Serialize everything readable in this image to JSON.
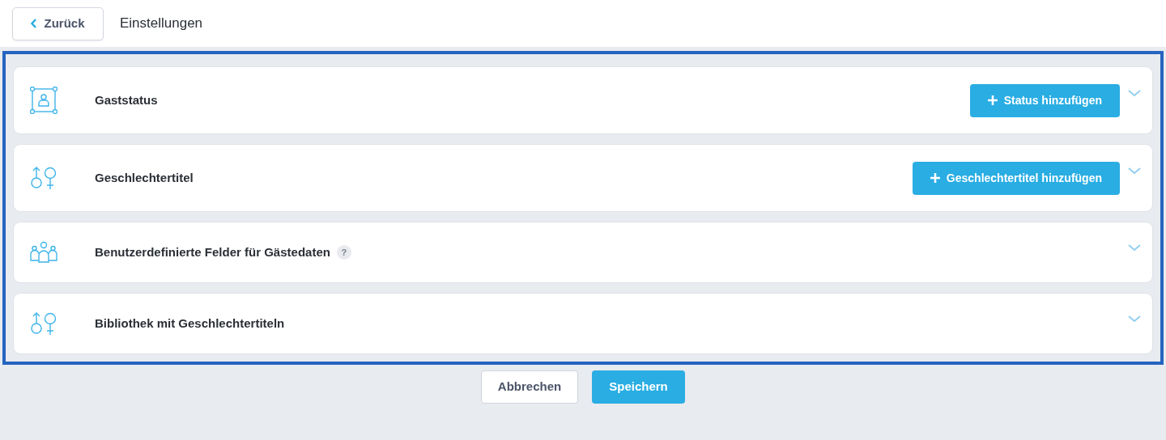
{
  "header": {
    "back_button": "Zurück",
    "title": "Einstellungen"
  },
  "panels": [
    {
      "kind": "guest",
      "title": "Gaststatus",
      "add_button": "Status hinzufügen",
      "expanded": false
    },
    {
      "kind": "gender",
      "title": "Geschlechtertitel",
      "add_button": "Geschlechtertitel hinzufügen",
      "expanded": false
    },
    {
      "kind": "group",
      "title": "Benutzerdefinierte Felder für Gästedaten",
      "help": "?",
      "expanded": false
    },
    {
      "kind": "gender",
      "title": "Bibliothek mit Geschlechtertiteln",
      "expanded": false
    }
  ],
  "footer": {
    "cancel_button": "Abbrechen",
    "save_button": "Speichern"
  }
}
